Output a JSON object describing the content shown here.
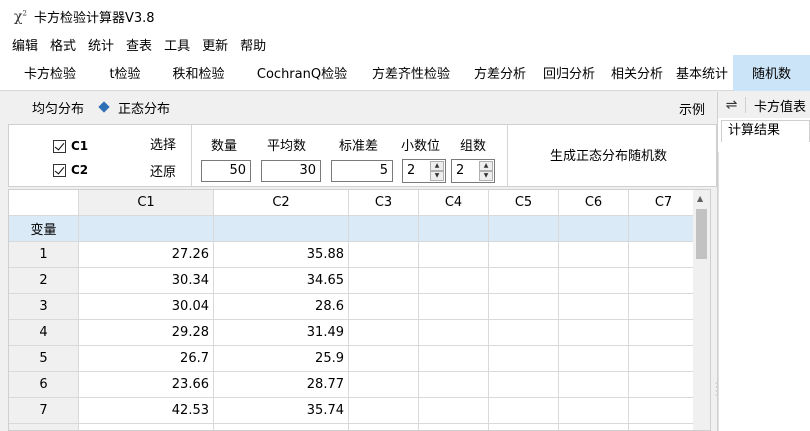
{
  "app": {
    "title": "卡方检验计算器V3.8",
    "icon": "chi-square-icon",
    "icon_glyph": "χ"
  },
  "menu": [
    "编辑",
    "格式",
    "统计",
    "查表",
    "工具",
    "更新",
    "帮助"
  ],
  "tabs": [
    "卡方检验",
    "t检验",
    "秩和检验",
    "CochranQ检验",
    "方差齐性检验",
    "方差分析",
    "回归分析",
    "相关分析",
    "基本统计",
    "随机数"
  ],
  "active_tab": "随机数",
  "subbar": {
    "uniform": "均匀分布",
    "normal": "正态分布",
    "example": "示例"
  },
  "params": {
    "checkbox_c1": "C1",
    "checkbox_c2": "C2",
    "select": "选择",
    "restore": "还原",
    "count_label": "数量",
    "count_value": "50",
    "mean_label": "平均数",
    "mean_value": "30",
    "sd_label": "标准差",
    "sd_value": "5",
    "decimals_label": "小数位",
    "decimals_value": "2",
    "groups_label": "组数",
    "groups_value": "2",
    "generate": "生成正态分布随机数"
  },
  "grid": {
    "columns": [
      "C1",
      "C2",
      "C3",
      "C4",
      "C5",
      "C6",
      "C7"
    ],
    "var_label": "变量",
    "rows": [
      {
        "n": "1",
        "c1": "27.26",
        "c2": "35.88"
      },
      {
        "n": "2",
        "c1": "30.34",
        "c2": "34.65"
      },
      {
        "n": "3",
        "c1": "30.04",
        "c2": "28.6"
      },
      {
        "n": "4",
        "c1": "29.28",
        "c2": "31.49"
      },
      {
        "n": "5",
        "c1": "26.7",
        "c2": "25.9"
      },
      {
        "n": "6",
        "c1": "23.66",
        "c2": "28.77"
      },
      {
        "n": "7",
        "c1": "42.53",
        "c2": "35.74"
      }
    ]
  },
  "right": {
    "title": "卡方值表",
    "tab": "计算结果",
    "swap_icon": "swap-icon"
  },
  "colors": {
    "active_tab_bg": "#cce4f7",
    "var_row_bg": "#dbeaf7",
    "diamond": "#2f6fb5"
  }
}
